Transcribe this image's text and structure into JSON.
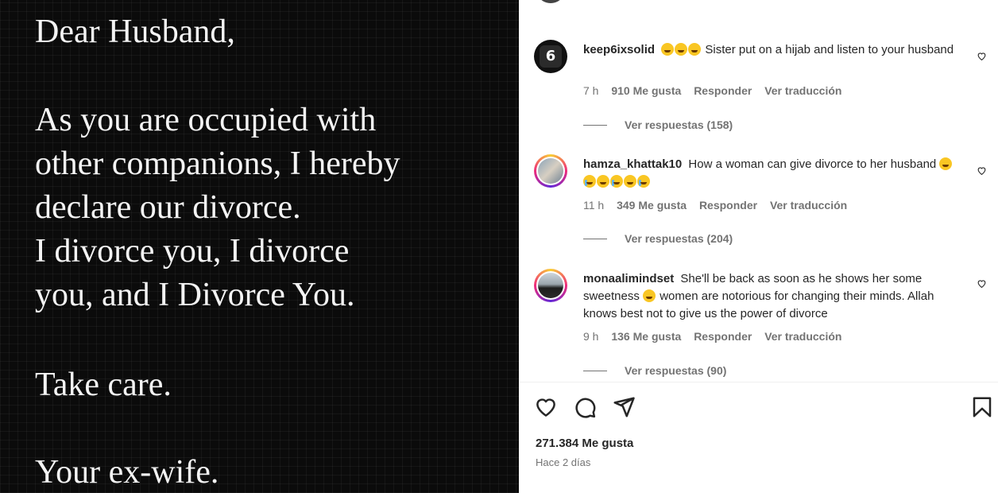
{
  "letter": {
    "lines": [
      "Dear Husband,",
      "As you are occupied with",
      "other companions, I hereby",
      "declare our divorce.",
      "I divorce you, I divorce",
      "you, and I Divorce You.",
      "Take care.",
      "Your ex-wife."
    ]
  },
  "comments": [
    {
      "username": "keep6ixsolid",
      "avatar_text": "6",
      "emojis": [
        "laughing-emoji",
        "laughing-emoji",
        "laughing-emoji"
      ],
      "text": "Sister put on a hijab and listen to your husband",
      "time": "7 h",
      "likes": "910 Me gusta",
      "reply_label": "Responder",
      "translate_label": "Ver traducción",
      "view_replies": "Ver respuestas (158)"
    },
    {
      "username": "hamza_khattak10",
      "text": "How a woman can give divorce to her husband",
      "emojis": [
        "rofl-emoji",
        "crying-emoji",
        "rofl-emoji",
        "crying-emoji",
        "rofl-emoji",
        "crying-emoji"
      ],
      "time": "11 h",
      "likes": "349 Me gusta",
      "reply_label": "Responder",
      "translate_label": "Ver traducción",
      "view_replies": "Ver respuestas (204)"
    },
    {
      "username": "monaalimindset",
      "text_before": "She'll be back as soon as he shows her some sweetness",
      "emojis": [
        "laughing-emoji"
      ],
      "text_after": "women are notorious for changing their minds. Allah knows best not to give us the power of divorce",
      "time": "9 h",
      "likes": "136 Me gusta",
      "reply_label": "Responder",
      "translate_label": "Ver traducción",
      "view_replies": "Ver respuestas (90)"
    }
  ],
  "footer": {
    "likes": "271.384 Me gusta",
    "posted": "Hace 2 días"
  },
  "icons": {
    "like": "heart-icon",
    "comment": "comment-bubble-icon",
    "share": "send-icon",
    "save": "bookmark-icon"
  }
}
